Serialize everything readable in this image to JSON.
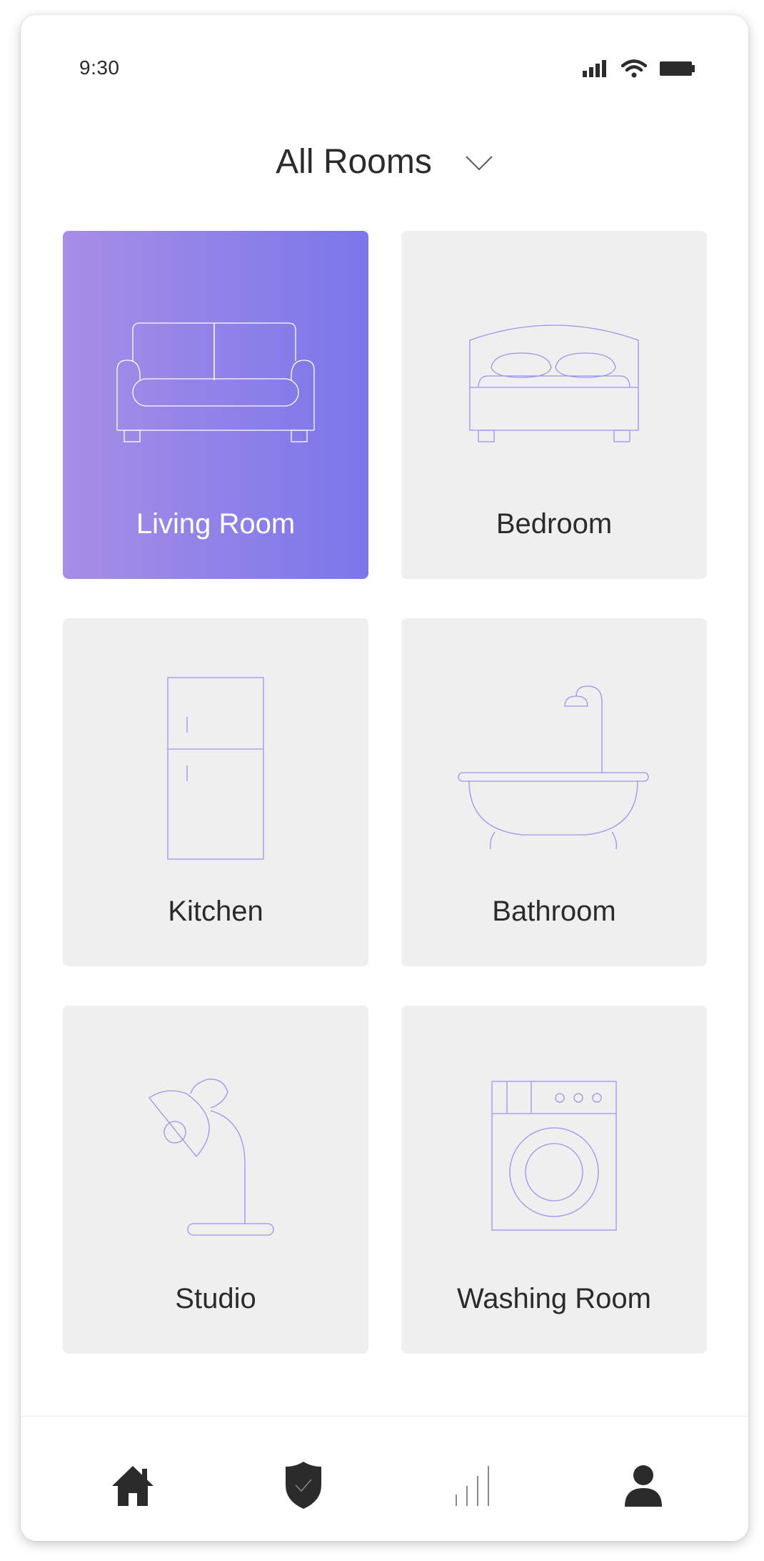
{
  "status_bar": {
    "time": "9:30",
    "icons": [
      "signal-icon",
      "wifi-icon",
      "battery-icon"
    ]
  },
  "header": {
    "title": "All Rooms",
    "dropdown_icon": "chevron-down-icon"
  },
  "rooms": [
    {
      "label": "Living Room",
      "icon": "sofa-icon",
      "selected": true
    },
    {
      "label": "Bedroom",
      "icon": "bed-icon",
      "selected": false
    },
    {
      "label": "Kitchen",
      "icon": "fridge-icon",
      "selected": false
    },
    {
      "label": "Bathroom",
      "icon": "bathtub-icon",
      "selected": false
    },
    {
      "label": "Studio",
      "icon": "desk-lamp-icon",
      "selected": false
    },
    {
      "label": "Washing Room",
      "icon": "washing-machine-icon",
      "selected": false
    }
  ],
  "bottom_nav": [
    {
      "icon": "home-icon",
      "active": true
    },
    {
      "icon": "shield-icon",
      "active": false
    },
    {
      "icon": "stats-icon",
      "active": false
    },
    {
      "icon": "user-icon",
      "active": false
    }
  ],
  "colors": {
    "accent_gradient_start": "#a68ee6",
    "accent_gradient_end": "#7b76ea",
    "icon_line": "#9b93f0",
    "card_background": "#efefef",
    "text": "#2b2b2b"
  }
}
